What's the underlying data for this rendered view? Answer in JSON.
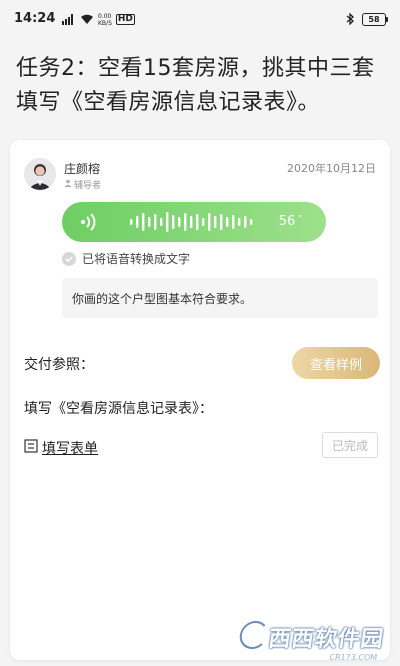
{
  "status_bar": {
    "time": "14:24",
    "net_speed": "0.00",
    "net_unit": "KB/S",
    "hd": "HD",
    "battery": "58"
  },
  "task": {
    "title": "任务2：空看15套房源，挑其中三套填写《空看房源信息记录表》。"
  },
  "message": {
    "mentor_name": "庄颜榕",
    "mentor_role": "辅导者",
    "date": "2020年10月12日",
    "voice_duration": "56",
    "voice_duration_mark": "\"",
    "converted_label": "已将语音转换成文字",
    "comment": "你画的这个户型图基本符合要求。"
  },
  "delivery": {
    "label": "交付参照：",
    "sample_button": "查看样例",
    "fill_label": "填写《空看房源信息记录表》：",
    "form_link": "填写表单",
    "done_button": "已完成"
  },
  "watermark": {
    "text": "西西软件园",
    "sub": "CR173.COM"
  },
  "colors": {
    "voice_green": "#6dce63",
    "gold_button": "#d9b779",
    "background": "#f4f4f4"
  }
}
